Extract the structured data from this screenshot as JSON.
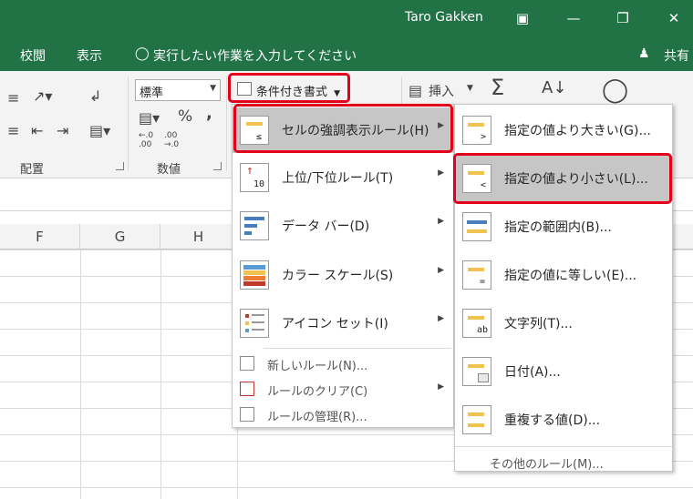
{
  "titlebar": {
    "user": "Taro Gakken"
  },
  "menubar": {
    "tab1": "校閲",
    "tab2": "表示",
    "tellme": "実行したい作業を入力してください",
    "share": "共有"
  },
  "ribbon": {
    "number_format": "標準",
    "percent": "%",
    "comma": ",",
    "dec_inc": ".00→.0",
    "cond_format": "条件付き書式",
    "insert": "挿入",
    "sum": "Σ",
    "group_align": "配置",
    "group_number": "数値"
  },
  "columns": [
    "F",
    "G",
    "H"
  ],
  "menu1": {
    "items": [
      {
        "label": "セルの強調表示ルール(H)"
      },
      {
        "label": "上位/下位ルール(T)"
      },
      {
        "label": "データ バー(D)"
      },
      {
        "label": "カラー スケール(S)"
      },
      {
        "label": "アイコン セット(I)"
      }
    ],
    "small": [
      {
        "label": "新しいルール(N)..."
      },
      {
        "label": "ルールのクリア(C)"
      },
      {
        "label": "ルールの管理(R)..."
      }
    ]
  },
  "menu2": {
    "items": [
      {
        "label": "指定の値より大きい(G)..."
      },
      {
        "label": "指定の値より小さい(L)..."
      },
      {
        "label": "指定の範囲内(B)..."
      },
      {
        "label": "指定の値に等しい(E)..."
      },
      {
        "label": "文字列(T)..."
      },
      {
        "label": "日付(A)..."
      },
      {
        "label": "重複する値(D)..."
      }
    ],
    "other": "その他のルール(M)..."
  },
  "icon_text": {
    "gt": ">",
    "lt": "<",
    "ten": "10",
    "ab": "ab"
  },
  "colors": {
    "excel_green": "#217346",
    "highlight_red": "#e2001a",
    "hover_gray": "#c6c6c6"
  }
}
